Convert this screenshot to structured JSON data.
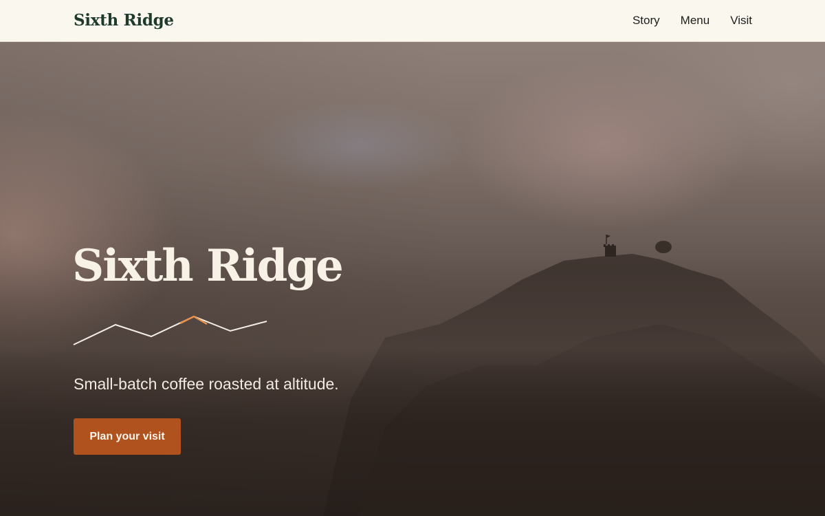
{
  "header": {
    "brand": "Sixth Ridge",
    "nav": [
      {
        "label": "Story"
      },
      {
        "label": "Menu"
      },
      {
        "label": "Visit"
      }
    ]
  },
  "hero": {
    "title": "Sixth Ridge",
    "tagline": "Small-batch coffee roasted at altitude.",
    "cta_label": "Plan your visit",
    "background_image": "misty-hilltop-with-tower-photo"
  },
  "colors": {
    "header_background": "#faf8ee",
    "brand_text": "#1f3a2c",
    "cta_background": "#b0521d",
    "ridge_accent": "#e8914a",
    "hero_text": "#f7f1e6"
  }
}
